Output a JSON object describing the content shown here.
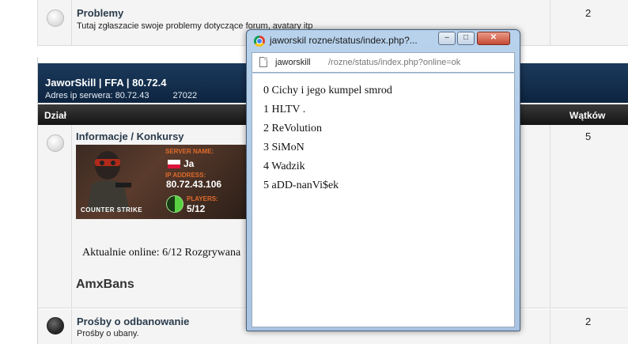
{
  "forum_rows": {
    "top": {
      "title": "Problemy",
      "description": "Tutaj zgłaszacie swoje problemy dotyczące forum, avatary itp",
      "count": "2"
    },
    "info": {
      "title": "Informacje / Konkursy",
      "count": "5"
    },
    "bottom": {
      "title": "Prośby o odbanowanie",
      "description": "Prośby o ubany.",
      "count": "2"
    }
  },
  "category": {
    "title": "JaworSkill | FFA | 80.72.4",
    "subtitle": "Adres ip serwera: 80.72.43",
    "subtitle_tail": "27022"
  },
  "columns": {
    "dzial": "Dział",
    "watkow": "Wątków"
  },
  "banner": {
    "server_name_label": "SERVER NAME:",
    "server_name_value": "Ja",
    "ip_label": "IP ADDRESS:",
    "ip_value": "80.72.43.106",
    "players_label": "PLAYERS:",
    "players_value": "5/12",
    "game_logo": "COUNTER STRIKE"
  },
  "online_text": "Aktualnie online: 6/12 Rozgrywana",
  "amxbans": "AmxBans",
  "popup": {
    "title": "jaworskil rozne/status/index.php?...",
    "url_host": "jaworskill",
    "url_path": "/rozne/status/index.php?online=ok",
    "players": [
      "0 Cichy i jego kumpel smrod",
      "1 HLTV .",
      "2 ReVolution",
      "3 SiMoN",
      "4 Wadzik",
      "5 aDD-nanVi$ek"
    ],
    "controls": {
      "minimize": "–",
      "maximize": "□",
      "close": "✕"
    }
  },
  "colors": {
    "category_header": "#0d2440",
    "column_bar": "#141414",
    "title_text": "#2a3b4c",
    "banner_accent": "#e06b2a",
    "players_pie": "#58d140",
    "players_fraction": 0.5,
    "window_frame": "#a9c4e2",
    "close_button": "#c64a32"
  }
}
